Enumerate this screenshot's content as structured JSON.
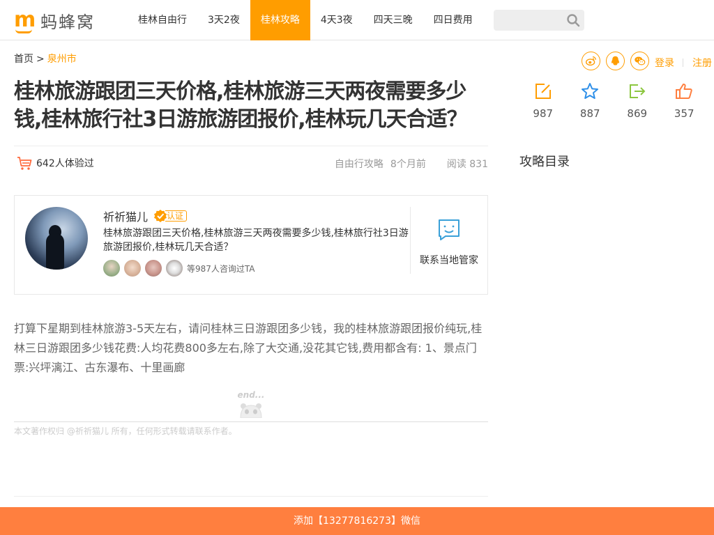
{
  "header": {
    "logo_text": "蚂蜂窝",
    "nav": [
      {
        "label": "桂林自由行"
      },
      {
        "label": "3天2夜"
      },
      {
        "label": "桂林攻略"
      },
      {
        "label": "4天3夜"
      },
      {
        "label": "四天三晚"
      },
      {
        "label": "四日费用"
      }
    ],
    "active_nav": "桂林攻略",
    "search_placeholder": ""
  },
  "breadcrumb": {
    "home": "首页",
    "sep": ">",
    "city": "泉州市"
  },
  "account": {
    "login": "登录",
    "register": "注册"
  },
  "share_icons": [
    "weibo-icon",
    "qq-icon",
    "wechat-icon"
  ],
  "article": {
    "title": "桂林旅游跟团三天价格,桂林旅游三天两夜需要多少钱,桂林旅行社3日游旅游团报价,桂林玩几天合适？",
    "experienced": "642人体验过",
    "category": "自由行攻略",
    "time": "8个月前",
    "reads": "阅读 831",
    "body": "打算下星期到桂林旅游3-5天左右，请问桂林三日游跟团多少钱，我的桂林旅游跟团报价纯玩,桂林三日游跟团多少钱花费:人均花费800多左右,除了大交通,没花其它钱,费用都含有: 1、景点门票:兴坪漓江、古东瀑布、十里画廊",
    "end_mark": "end...",
    "copyright": "本文著作权归 @祈祈猫儿 所有，任何形式转载请联系作者。"
  },
  "stats": [
    {
      "icon": "edit-icon",
      "value": "987"
    },
    {
      "icon": "star-icon",
      "value": "887"
    },
    {
      "icon": "share-out-icon",
      "value": "869"
    },
    {
      "icon": "thumb-up-icon",
      "value": "357"
    }
  ],
  "toc": {
    "title": "攻略目录"
  },
  "author": {
    "name": "祈祈猫儿",
    "verified_label": "认证",
    "desc": "桂林旅游跟团三天价格,桂林旅游三天两夜需要多少钱,桂林旅行社3日游旅游团报价,桂林玩几天合适？",
    "consult_text": "等987人咨询过TA",
    "contact_label": "联系当地管家"
  },
  "bottom_bar": {
    "text": "添加【13277816273】微信"
  },
  "colors": {
    "brand": "#ff9d00",
    "bottom_bar": "#ff7f3f",
    "weibo": "#ff9d00",
    "star": "#2e8fe8",
    "share_out": "#8cc63f",
    "thumb": "#ff7f3f",
    "contact": "#3aa0d8"
  }
}
